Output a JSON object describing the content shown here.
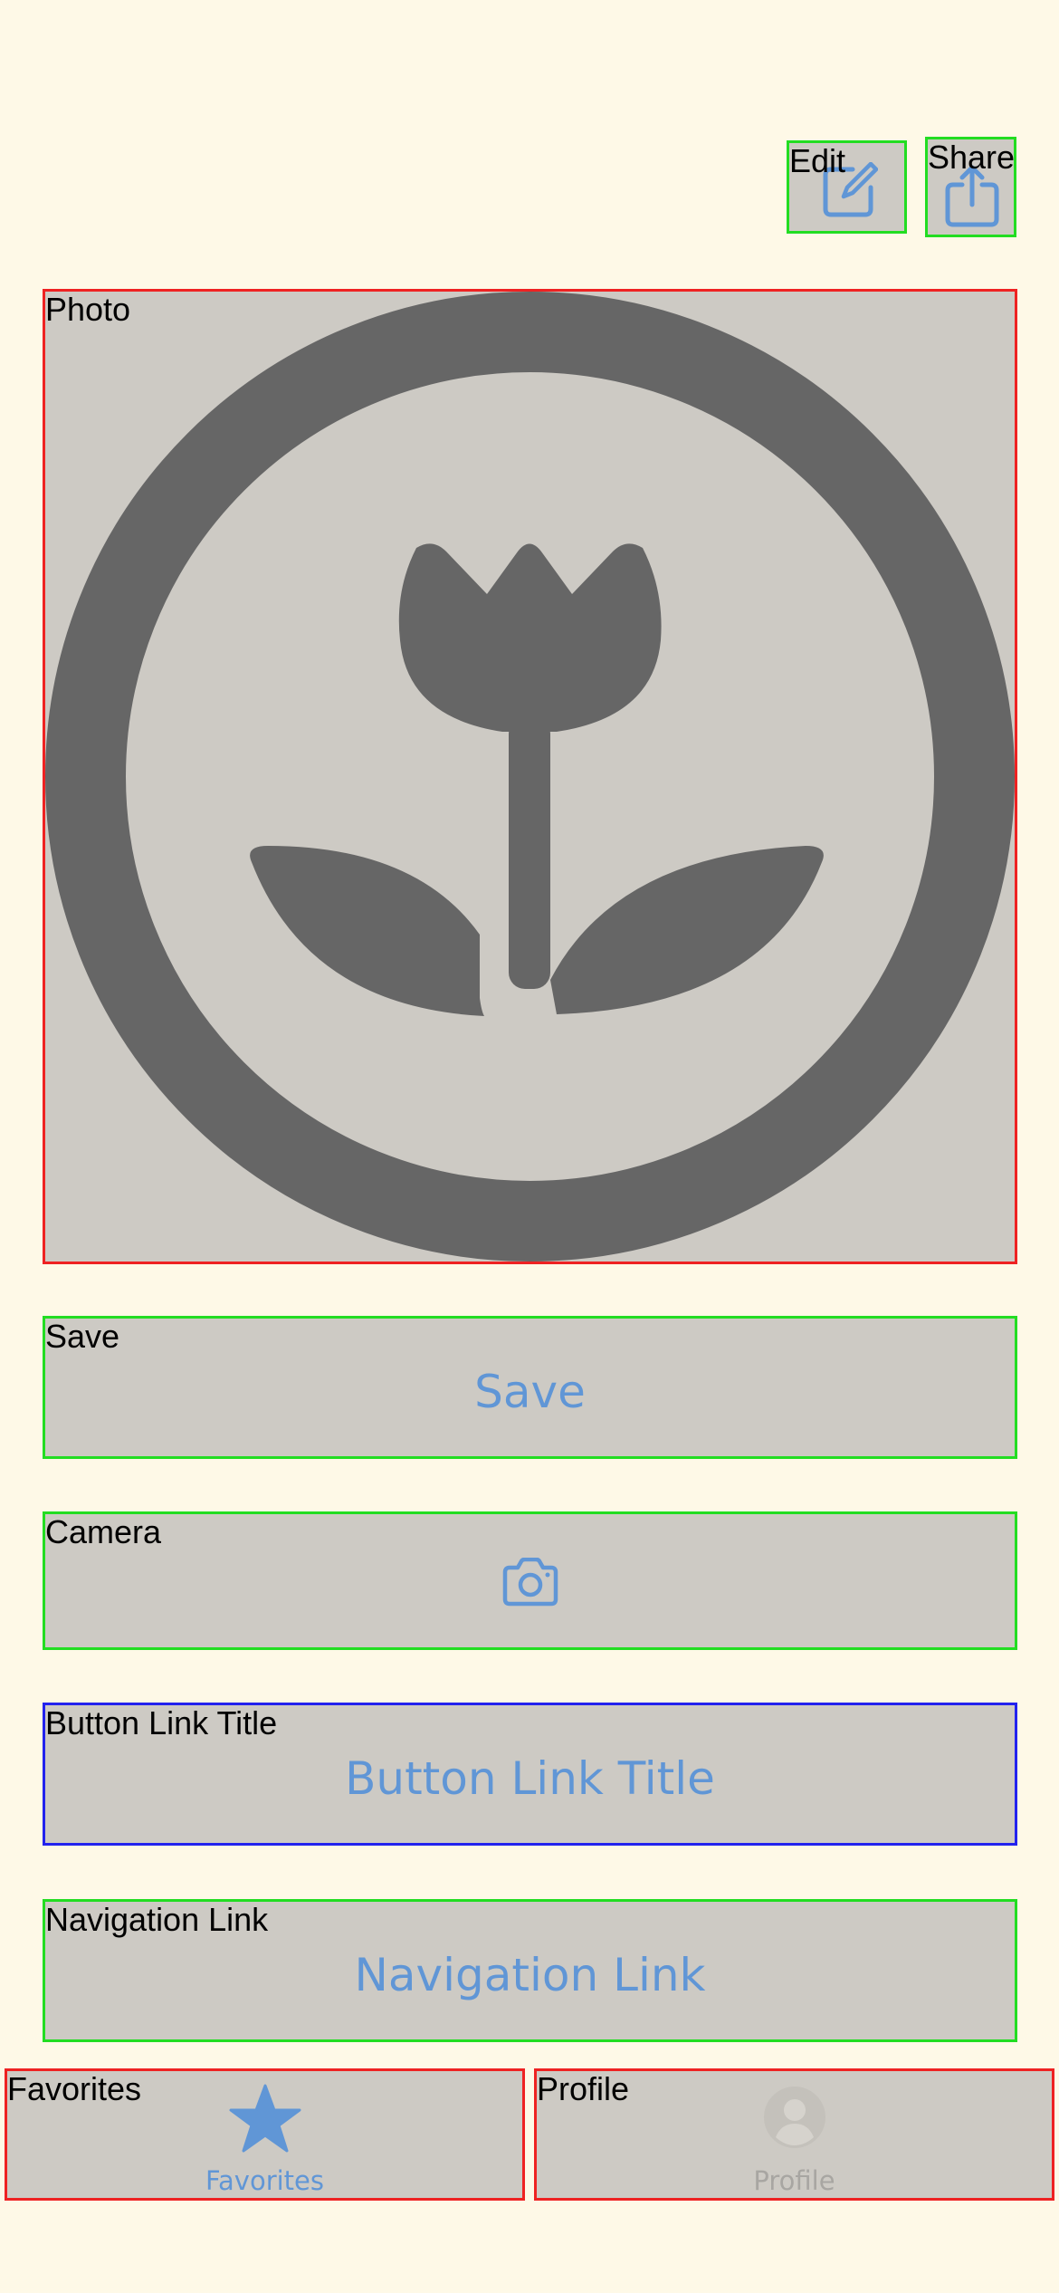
{
  "toolbar": {
    "edit_label": "Edit",
    "share_label": "Share",
    "edit_icon": "square-and-pencil-icon",
    "share_icon": "square-and-arrow-up-icon"
  },
  "photo": {
    "label": "Photo",
    "icon": "camera-macro-circle-icon"
  },
  "buttons": {
    "save": {
      "label": "Save",
      "text": "Save"
    },
    "camera": {
      "label": "Camera",
      "icon": "camera-icon"
    },
    "button_link": {
      "label": "Button Link Title",
      "text": "Button Link Title"
    },
    "navigation_link": {
      "label": "Navigation Link",
      "text": "Navigation Link"
    }
  },
  "tabbar": {
    "favorites": {
      "label": "Favorites",
      "text": "Favorites",
      "icon": "star-fill-icon",
      "selected": true
    },
    "profile": {
      "label": "Profile",
      "text": "Profile",
      "icon": "person-circle-fill-icon",
      "selected": false
    }
  },
  "colors": {
    "background": "#FEF9E7",
    "control_fill": "#CDCAC4",
    "accent": "#6096D6",
    "inactive": "#A8A6A2",
    "icon_dark": "#666666"
  }
}
